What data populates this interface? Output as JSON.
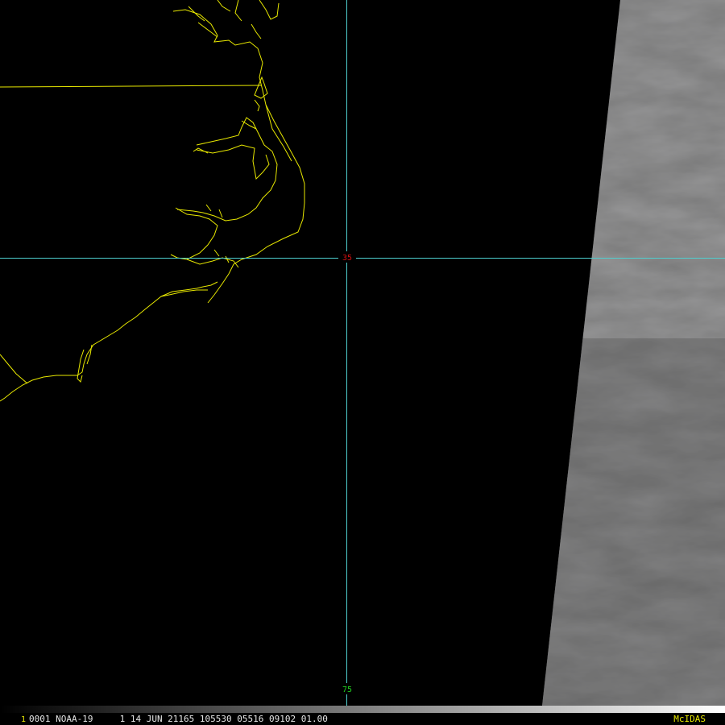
{
  "map": {
    "latitude_label": "35",
    "longitude_label": "75"
  },
  "status": {
    "frame": "1",
    "text": "0001 NOAA-19     1 14 JUN 21165 105530 05516 09102 01.00",
    "brand": "McIDAS"
  },
  "colors": {
    "coastline": "#e8e800",
    "gridline": "#4fd0d0",
    "lat_label": "#d01010",
    "lon_label": "#20d020"
  }
}
